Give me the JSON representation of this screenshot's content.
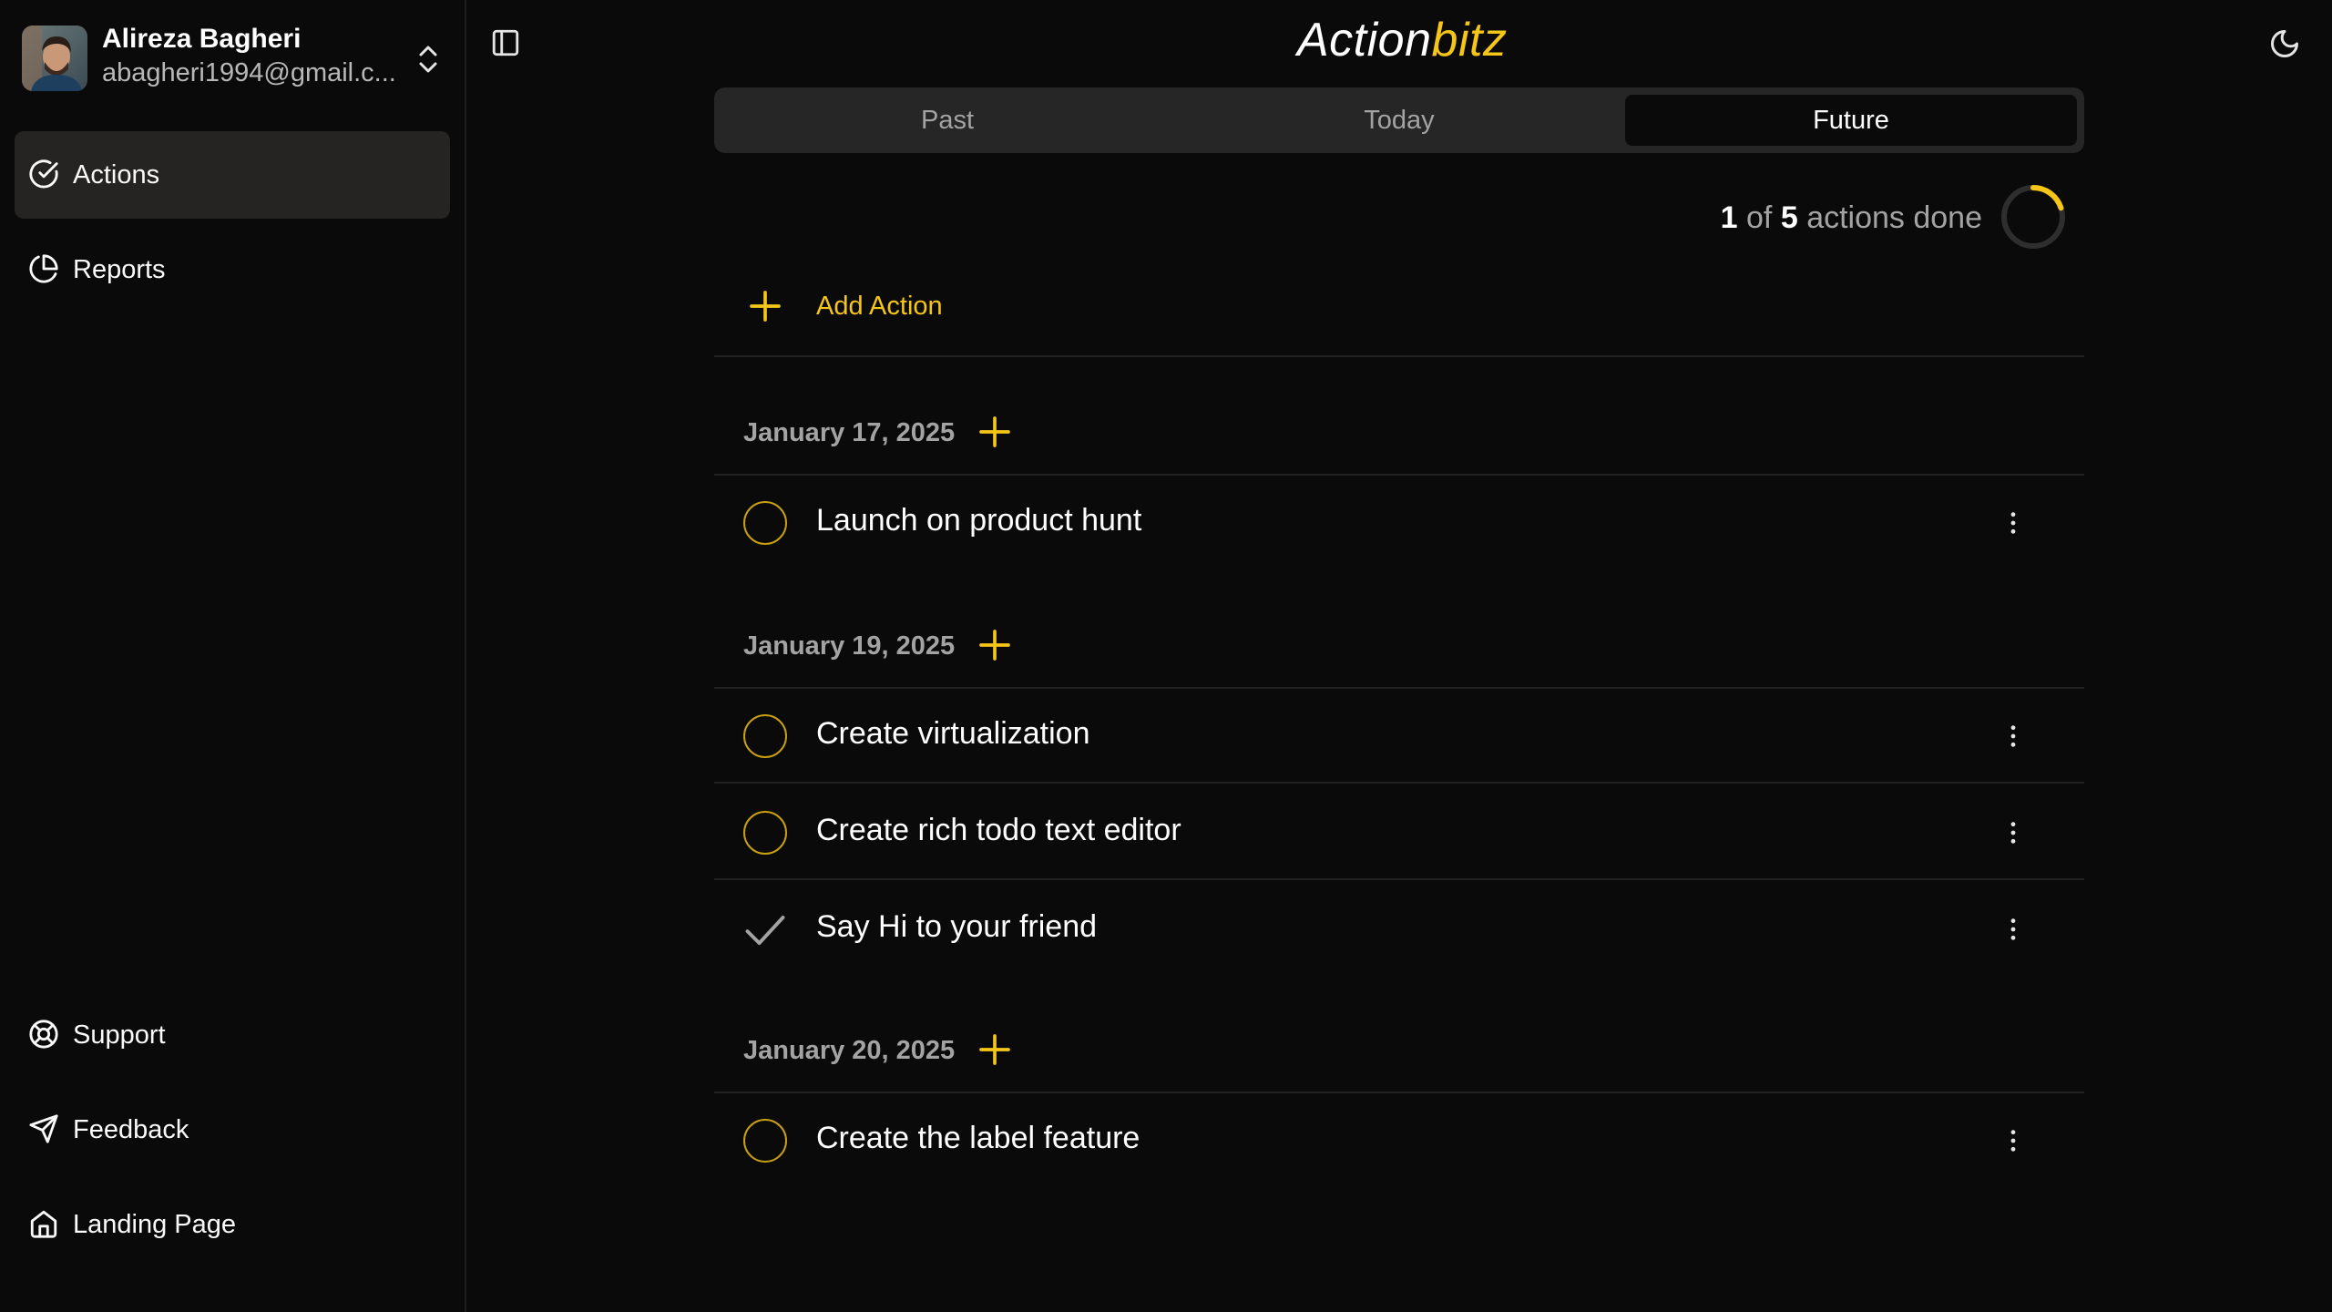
{
  "app": {
    "brand_part1": "Action",
    "brand_part2": "bitz",
    "accent_color": "#f5c518"
  },
  "user": {
    "name": "Alireza Bagheri",
    "email": "abagheri1994@gmail.c..."
  },
  "sidebar": {
    "nav": [
      {
        "label": "Actions",
        "icon": "check-circle-icon",
        "active": true
      },
      {
        "label": "Reports",
        "icon": "pie-chart-icon",
        "active": false
      }
    ],
    "footer": [
      {
        "label": "Support",
        "icon": "life-buoy-icon"
      },
      {
        "label": "Feedback",
        "icon": "send-icon"
      },
      {
        "label": "Landing Page",
        "icon": "home-icon"
      }
    ]
  },
  "tabs": [
    {
      "label": "Past",
      "active": false
    },
    {
      "label": "Today",
      "active": false
    },
    {
      "label": "Future",
      "active": true
    }
  ],
  "progress": {
    "done": "1",
    "of_text": "of",
    "total": "5",
    "suffix": "actions done",
    "fraction": 0.2
  },
  "add_action_label": "Add Action",
  "groups": [
    {
      "date": "January 17, 2025",
      "tasks": [
        {
          "title": "Launch on product hunt",
          "done": false
        }
      ]
    },
    {
      "date": "January 19, 2025",
      "tasks": [
        {
          "title": "Create virtualization",
          "done": false
        },
        {
          "title": "Create rich todo text editor",
          "done": false
        },
        {
          "title": "Say Hi to your friend",
          "done": true
        }
      ]
    },
    {
      "date": "January 20, 2025",
      "tasks": [
        {
          "title": "Create the label feature",
          "done": false
        }
      ]
    }
  ]
}
